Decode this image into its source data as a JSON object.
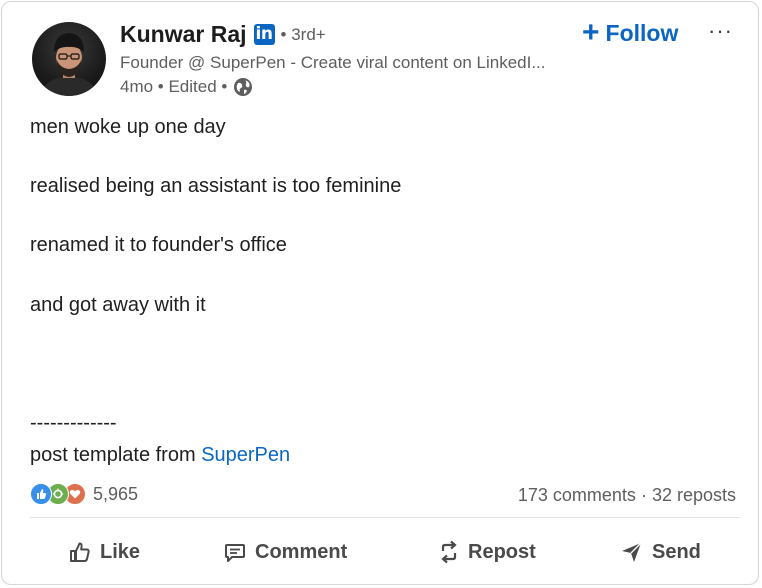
{
  "post": {
    "author_name": "Kunwar Raj",
    "badge_letters": "in",
    "degree": "• 3rd+",
    "headline": "Founder @ SuperPen - Create viral content on LinkedI...",
    "meta": "4mo • Edited •",
    "follow_label": "Follow",
    "more_label": "···",
    "lines": [
      "men woke up one day",
      "realised being an assistant is too feminine",
      "renamed it to founder's office",
      "and got away with it"
    ],
    "separator": "-------------",
    "template_prefix": "post template from ",
    "template_link": "SuperPen"
  },
  "social": {
    "reaction_count": "5,965",
    "comments": "173 comments",
    "dot": " · ",
    "reposts": "32 reposts"
  },
  "actions": {
    "like": "Like",
    "comment": "Comment",
    "repost": "Repost",
    "send": "Send"
  },
  "colors": {
    "accent": "#0a66c2",
    "text": "#1f1f1f",
    "muted": "#5e5e5e"
  },
  "icons": [
    "globe-icon",
    "plus-icon",
    "more-icon",
    "like-icon",
    "celebrate-icon",
    "love-icon",
    "thumbs-up-icon",
    "comment-icon",
    "repost-icon",
    "send-icon"
  ]
}
